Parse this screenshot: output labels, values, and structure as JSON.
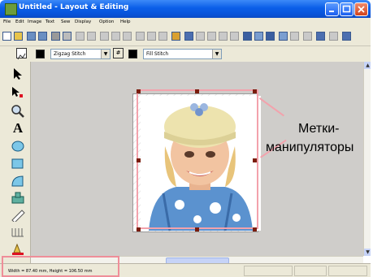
{
  "window": {
    "title": "Untitled - Layout & Editing"
  },
  "menu": [
    "File",
    "Edit",
    "Image",
    "Text",
    "Sew",
    "Display",
    "Option",
    "Help"
  ],
  "toolbar2": {
    "stitch_type": "Zigzag Stitch",
    "fill_type": "Fill Stitch"
  },
  "status": {
    "text": "Width = 87.40 mm, Height = 106.50 mm"
  },
  "annotation": {
    "line1": "Метки-",
    "line2": "манипуляторы"
  },
  "colors": {
    "titlebar": "#0a5ee8",
    "highlight_pink": "#ef8e99",
    "canvas_bg": "#cfcdca",
    "handle": "#7a1d0d"
  }
}
